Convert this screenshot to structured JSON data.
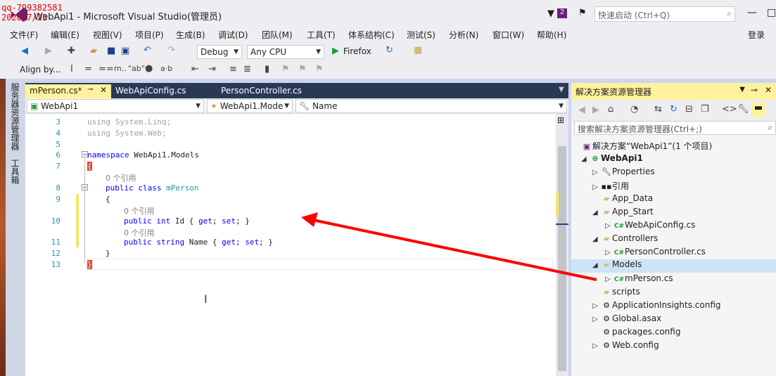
{
  "window": {
    "title": "WebApi1 - Microsoft Visual Studio(管理员)"
  },
  "watermark": {
    "line1": "qq-799382581",
    "line2": "2020/7/23"
  },
  "titlebar": {
    "notif_count": "2",
    "quicklaunch_placeholder": "快速启动 (Ctrl+Q)"
  },
  "menu": [
    "文件(F)",
    "编辑(E)",
    "视图(V)",
    "项目(P)",
    "生成(B)",
    "调试(D)",
    "团队(M)",
    "工具(T)",
    "体系结构(C)",
    "测试(S)",
    "分析(N)",
    "窗口(W)",
    "帮助(H)"
  ],
  "signin": "登录",
  "toolbar": {
    "config": "Debug",
    "platform": "Any CPU",
    "run": "Firefox",
    "align": "Align by..."
  },
  "left_tabs": [
    "服务器资源管理器",
    "工具箱"
  ],
  "tabs": [
    {
      "label": "mPerson.cs*",
      "active": true
    },
    {
      "label": "WebApiConfig.cs",
      "active": false
    },
    {
      "label": "PersonController.cs",
      "active": false
    }
  ],
  "navbar": {
    "project": "WebApi1",
    "type": "WebApi1.Mode",
    "member": "Name"
  },
  "code_lines": {
    "l3": {
      "num": "3",
      "a": "using System.Linq;"
    },
    "l4": {
      "num": "4",
      "a": "using System.Web;"
    },
    "l5": {
      "num": "5"
    },
    "l6": {
      "num": "6",
      "kw": "namespace",
      "rest": " WebApi1.Models"
    },
    "l7": {
      "num": "7",
      "a": "{"
    },
    "ref1": "0 个引用",
    "l8": {
      "num": "8",
      "kw": "public class",
      "ty": " mPerson"
    },
    "l9": {
      "num": "9",
      "a": "{"
    },
    "ref2": "0 个引用",
    "l10": {
      "num": "10",
      "kw": "public int",
      "rest": " Id { ",
      "kw2": "get",
      "mid": "; ",
      "kw3": "set",
      "end": "; }"
    },
    "ref3": "0 个引用",
    "l11": {
      "num": "11",
      "kw": "public string",
      "rest": " Name { ",
      "kw2": "get",
      "mid": "; ",
      "kw3": "set",
      "end": "; }"
    },
    "l12": {
      "num": "12",
      "a": "}"
    },
    "l13": {
      "num": "13",
      "a": "}"
    }
  },
  "solution": {
    "title": "解决方案资源管理器",
    "search_placeholder": "搜索解决方案资源管理器(Ctrl+;)",
    "items": [
      {
        "label": "解决方案“WebApi1”(1 个项目)"
      },
      {
        "label": "WebApi1"
      },
      {
        "label": "Properties"
      },
      {
        "label": "引用"
      },
      {
        "label": "App_Data"
      },
      {
        "label": "App_Start"
      },
      {
        "label": "WebApiConfig.cs"
      },
      {
        "label": "Controllers"
      },
      {
        "label": "PersonController.cs"
      },
      {
        "label": "Models"
      },
      {
        "label": "mPerson.cs"
      },
      {
        "label": "scripts"
      },
      {
        "label": "ApplicationInsights.config"
      },
      {
        "label": "Global.asax"
      },
      {
        "label": "packages.config"
      },
      {
        "label": "Web.config"
      }
    ]
  },
  "colors": {
    "accent": "#68217a",
    "active_tab": "#fff29d",
    "arrow": "#ff0000"
  }
}
